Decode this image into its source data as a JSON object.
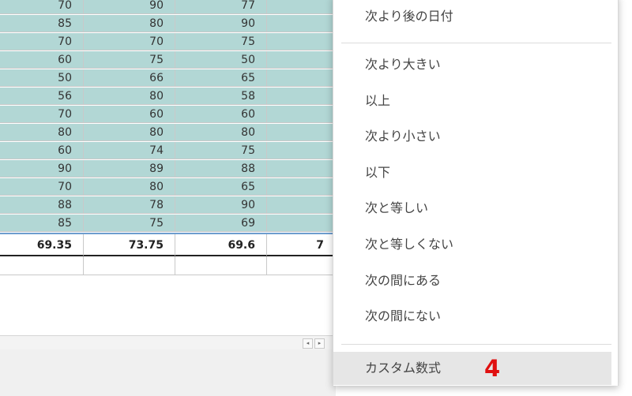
{
  "sheet": {
    "top_row": [
      "70",
      "90",
      "77",
      ""
    ],
    "rows": [
      [
        "85",
        "80",
        "90",
        ""
      ],
      [
        "70",
        "70",
        "75",
        ""
      ],
      [
        "60",
        "75",
        "50",
        ""
      ],
      [
        "50",
        "66",
        "65",
        ""
      ],
      [
        "56",
        "80",
        "58",
        ""
      ],
      [
        "70",
        "60",
        "60",
        ""
      ],
      [
        "80",
        "80",
        "80",
        ""
      ],
      [
        "60",
        "74",
        "75",
        ""
      ],
      [
        "90",
        "89",
        "88",
        ""
      ],
      [
        "70",
        "80",
        "65",
        ""
      ],
      [
        "88",
        "78",
        "90",
        ""
      ],
      [
        "85",
        "75",
        "69",
        ""
      ]
    ],
    "average_row": [
      "69.35",
      "73.75",
      "69.6",
      "7"
    ],
    "selection_color": "#b2d7d5",
    "scroll_left_icon": "◂",
    "scroll_right_icon": "▸"
  },
  "menu": {
    "date_after": "次より後の日付",
    "items": [
      "次より大きい",
      "以上",
      "次より小さい",
      "以下",
      "次と等しい",
      "次と等しくない",
      "次の間にある",
      "次の間にない"
    ],
    "custom_formula": "カスタム数式",
    "step_label": "4",
    "step_color": "#e01010"
  }
}
